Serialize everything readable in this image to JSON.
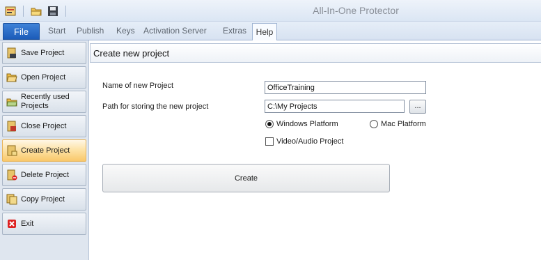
{
  "app": {
    "title": "All-In-One Protector"
  },
  "quick_access": [
    {
      "icon": "app-menu-icon"
    },
    {
      "icon": "open-folder-icon"
    },
    {
      "icon": "save-disk-icon"
    }
  ],
  "ribbon": {
    "file_label": "File",
    "tabs": [
      {
        "label": "Start"
      },
      {
        "label": "Publish"
      },
      {
        "label": "Keys"
      },
      {
        "label": "Activation Server"
      },
      {
        "label": "Extras"
      }
    ],
    "active_tab": "Help"
  },
  "sidebar": {
    "items": [
      {
        "label": "Save Project",
        "icon": "save-icon"
      },
      {
        "label": "Open Project",
        "icon": "open-folder-icon"
      },
      {
        "label": "Recently used Projects",
        "icon": "recent-folder-icon"
      },
      {
        "label": "Close Project",
        "icon": "close-project-icon"
      },
      {
        "label": "Create Project",
        "icon": "create-project-icon",
        "active": true
      },
      {
        "label": "Delete Project",
        "icon": "delete-project-icon"
      },
      {
        "label": "Copy Project",
        "icon": "copy-project-icon"
      },
      {
        "label": "Exit",
        "icon": "exit-icon"
      }
    ]
  },
  "panel": {
    "title": "Create new project",
    "name_label": "Name of new Project",
    "name_value": "OfficeTraining",
    "path_label": "Path for storing the new project",
    "path_value": "C:\\My Projects",
    "browse_label": "...",
    "platform_windows": "Windows Platform",
    "platform_mac": "Mac Platform",
    "selected_platform": "Windows Platform",
    "video_audio_label": "Video/Audio Project",
    "video_audio_checked": false,
    "create_label": "Create"
  },
  "colors": {
    "file_tab": "#1c5cb9",
    "active_sidebar": "#f9c86a",
    "title_text": "#8a8f98"
  }
}
